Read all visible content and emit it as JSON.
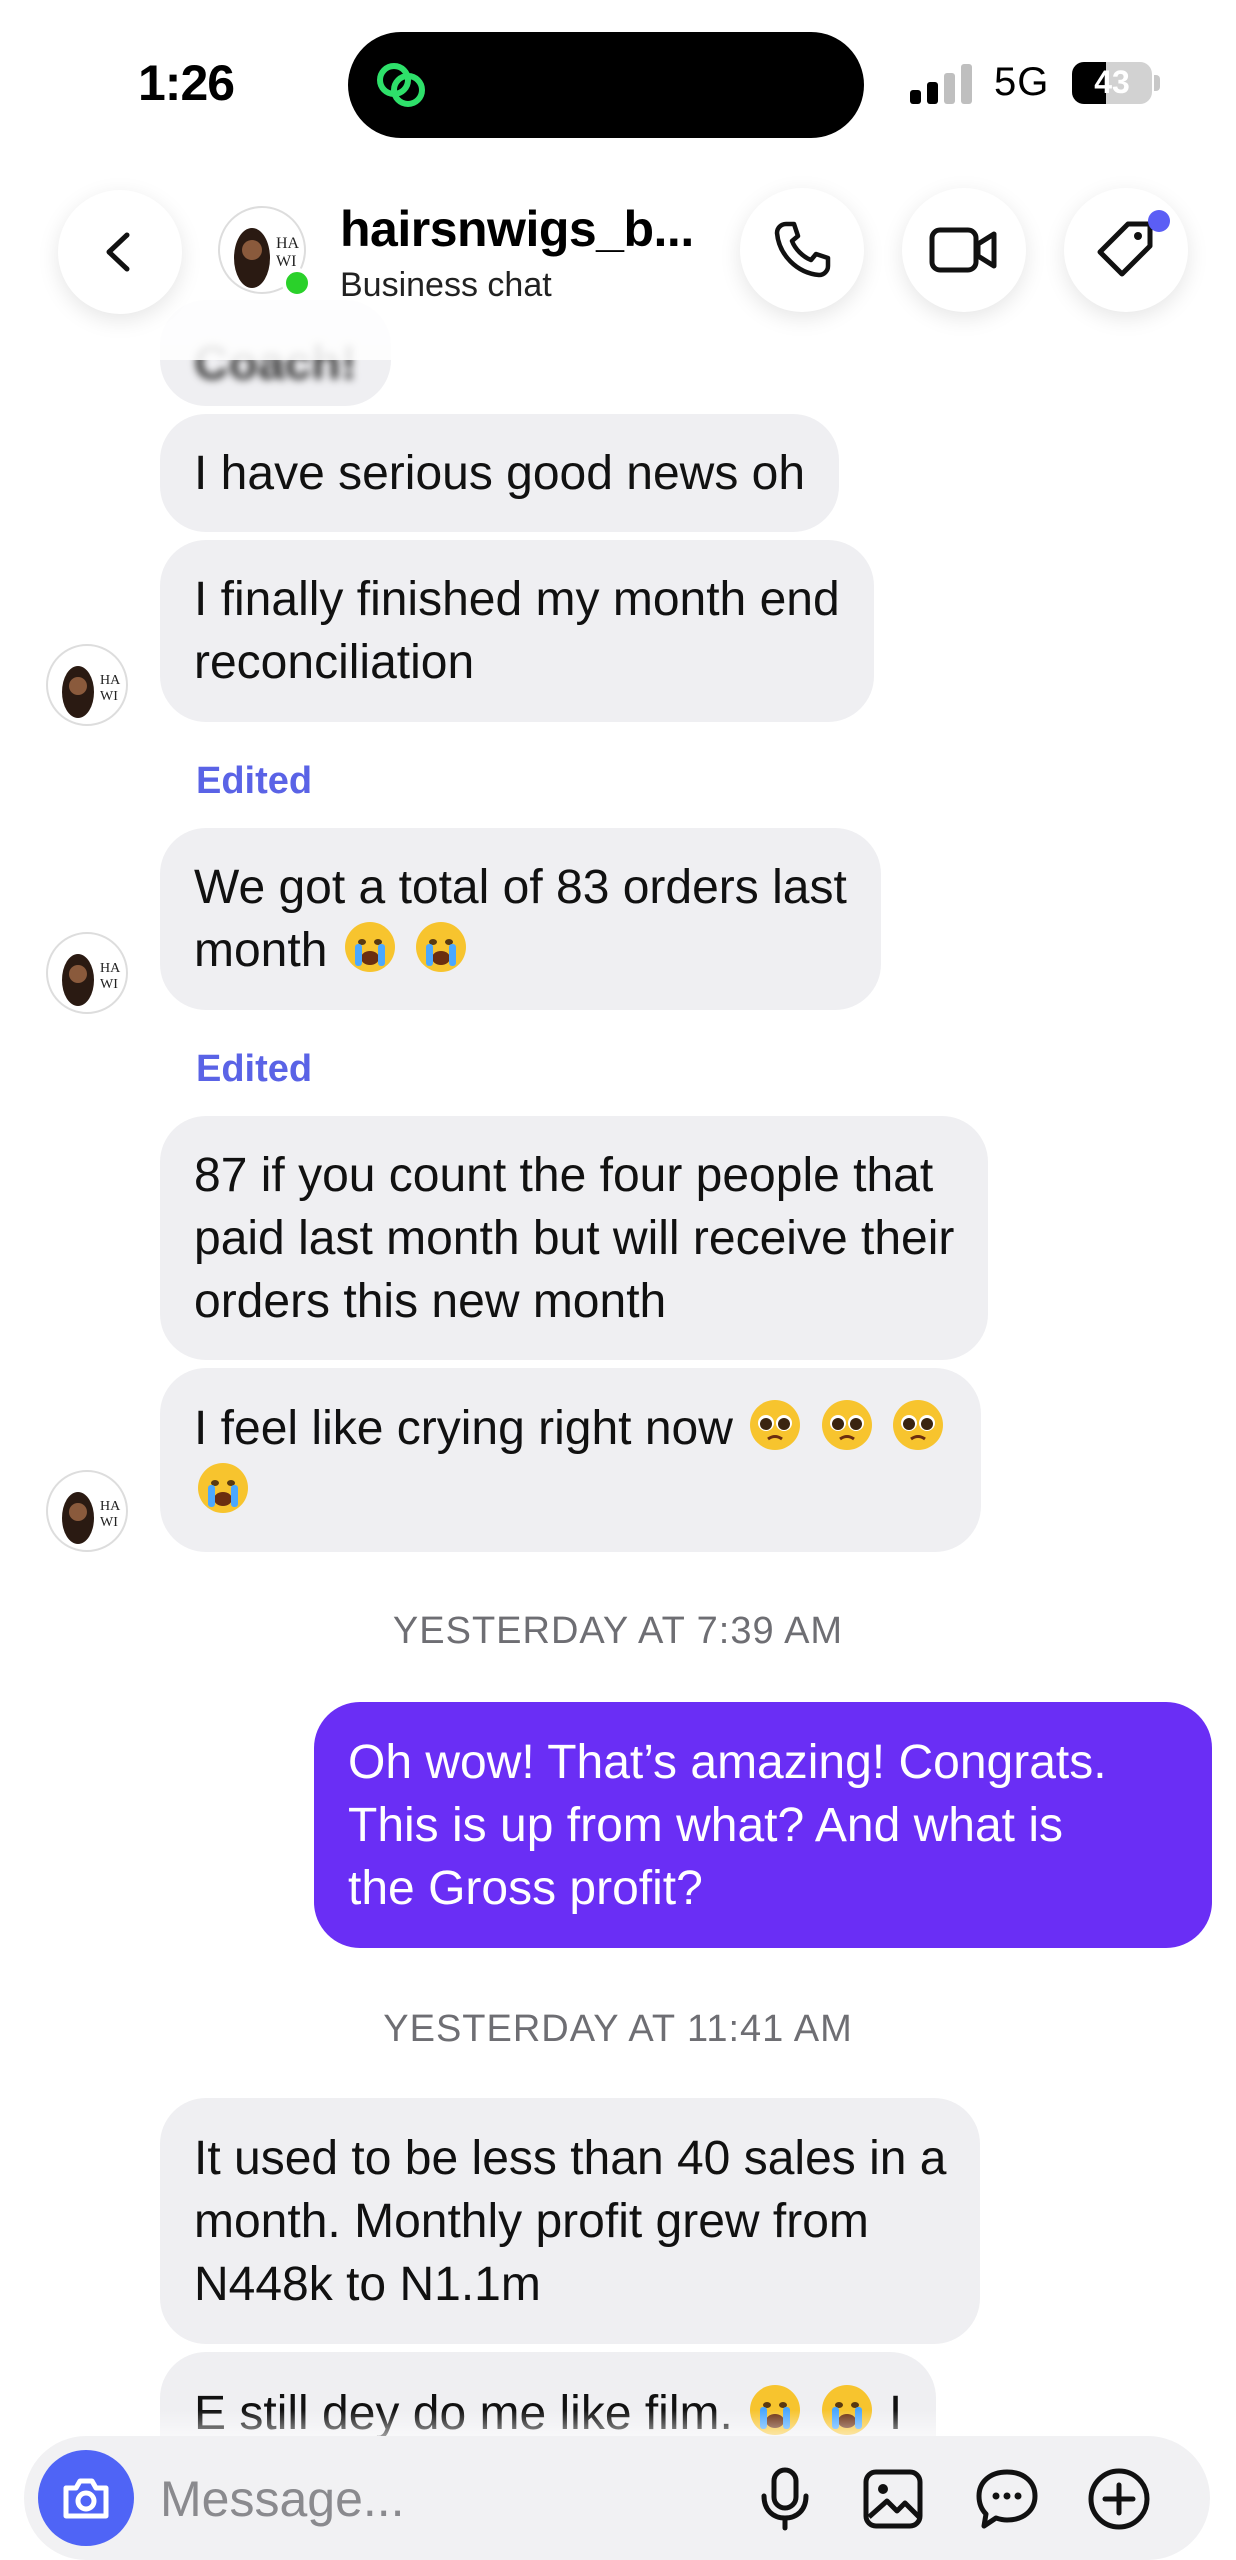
{
  "status_bar": {
    "time": "1:26",
    "network": "5G",
    "battery": "43",
    "battery_level": 0.43
  },
  "header": {
    "name": "hairsnwigs_b...",
    "subtitle": "Business chat"
  },
  "messages": {
    "m0": "Coach!",
    "m1": "I have serious good news oh",
    "m2_l1": "I finally finished my month end",
    "m2_l2": "reconciliation",
    "edited_1": "Edited",
    "m3_l1": "We got a total of 83 orders last",
    "m3_l2": "month",
    "edited_2": "Edited",
    "m4_l1": "87 if you count the four people that",
    "m4_l2": "paid last month but will receive their",
    "m4_l3": "orders this new month",
    "m5_l1": "I feel like crying right now",
    "ts1": "YESTERDAY AT 7:39 AM",
    "m6_l1": "Oh wow! That’s amazing! Congrats.",
    "m6_l2": "This is up from what? And what is",
    "m6_l3": "the Gross profit?",
    "ts2": "YESTERDAY AT 11:41 AM",
    "m7_l1": "It used to be less than 40 sales in a",
    "m7_l2": "month. Monthly profit grew from",
    "m7_l3": "N448k to N1.1m",
    "m8_l1": "E still dey do me like film.",
    "m8_tail": "I"
  },
  "composer": {
    "placeholder": "Message..."
  },
  "colors": {
    "accent": "#6a2ef5",
    "incoming_bubble": "#efeff2",
    "edited": "#5a63e6",
    "camera": "#4f64f6",
    "online": "#2ad12a"
  },
  "icons": [
    "back-icon",
    "phone-icon",
    "video-icon",
    "tag-icon",
    "camera-icon",
    "microphone-icon",
    "image-icon",
    "sticker-icon",
    "plus-icon",
    "crying-emoji",
    "pleading-emoji"
  ]
}
